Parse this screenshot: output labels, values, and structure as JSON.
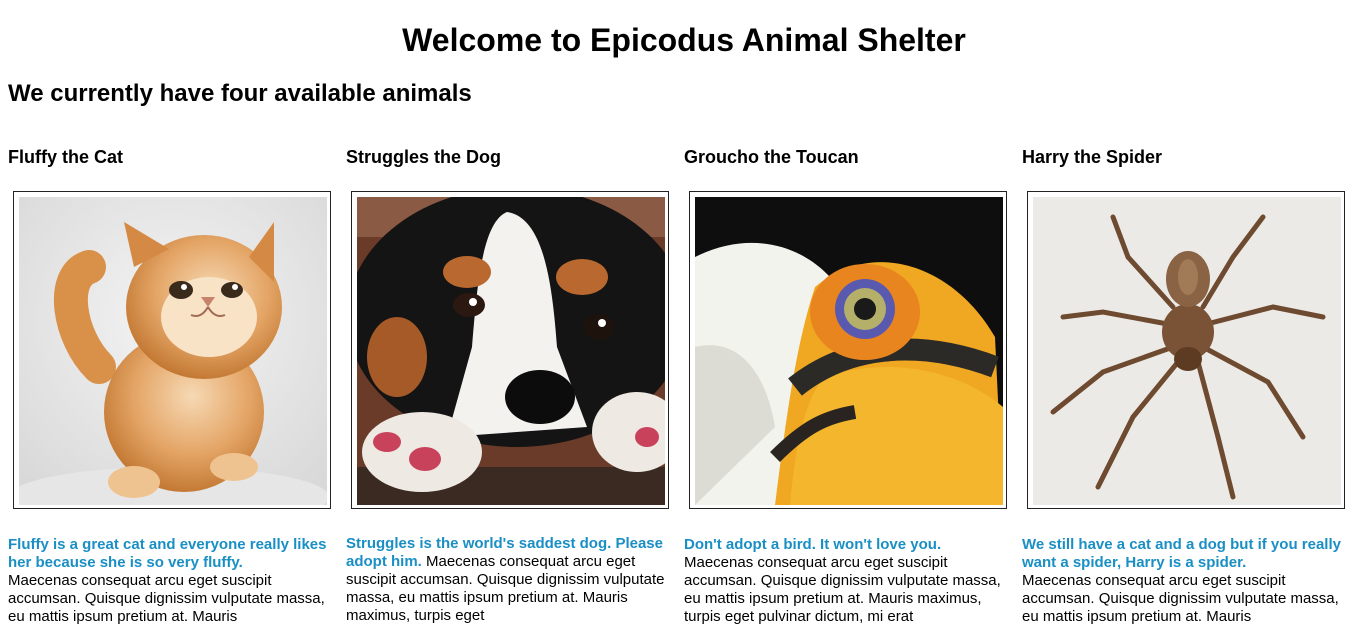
{
  "page": {
    "title": "Welcome to Epicodus Animal Shelter",
    "subtitle": "We currently have four available animals"
  },
  "animals": [
    {
      "name": "Fluffy the Cat",
      "lead": "Fluffy is a great cat and everyone really likes her because she is so very fluffy.",
      "body": "Maecenas consequat arcu eget suscipit accumsan. Quisque dignissim vulputate massa, eu mattis ipsum pretium at. Mauris"
    },
    {
      "name": "Struggles the Dog",
      "lead": "Struggles is the world's saddest dog. Please adopt him.",
      "body": "Maecenas consequat arcu eget suscipit accumsan. Quisque dignissim vulputate massa, eu mattis ipsum pretium at. Mauris maximus, turpis eget"
    },
    {
      "name": "Groucho the Toucan",
      "lead": "Don't adopt a bird. It won't love you.",
      "body": "Maecenas consequat arcu eget suscipit accumsan. Quisque dignissim vulputate massa, eu mattis ipsum pretium at. Mauris maximus, turpis eget pulvinar dictum, mi erat"
    },
    {
      "name": "Harry the Spider",
      "lead": "We still have a cat and a dog but if you really want a spider, Harry is a spider.",
      "body": "Maecenas consequat arcu eget suscipit accumsan. Quisque dignissim vulputate massa, eu mattis ipsum pretium at. Mauris"
    }
  ],
  "colors": {
    "lead_text": "#1a8fc4",
    "body_text": "#000000",
    "background": "#ffffff"
  }
}
